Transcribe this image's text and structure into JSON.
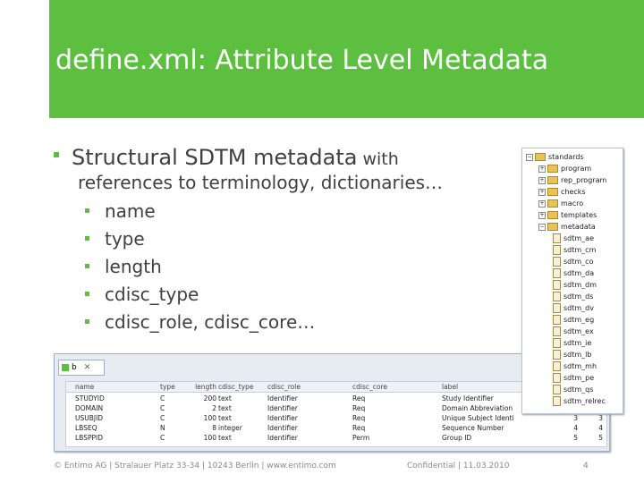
{
  "slide": {
    "title": "define.xml: Attribute Level Metadata",
    "bullet_main_large": "Structural SDTM metadata",
    "bullet_main_small": " with",
    "bullet_main_line2": "references to terminology, dictionaries…",
    "sub_bullets": [
      "name",
      "type",
      "length",
      "cdisc_type",
      "cdisc_role, cdisc_core…"
    ]
  },
  "tree": {
    "items": [
      {
        "label": "standards",
        "kind": "folder"
      },
      {
        "label": "program",
        "kind": "folder"
      },
      {
        "label": "rep_program",
        "kind": "folder"
      },
      {
        "label": "checks",
        "kind": "folder"
      },
      {
        "label": "macro",
        "kind": "folder"
      },
      {
        "label": "templates",
        "kind": "folder"
      },
      {
        "label": "metadata",
        "kind": "folder"
      },
      {
        "label": "sdtm_ae",
        "kind": "file"
      },
      {
        "label": "sdtm_cm",
        "kind": "file"
      },
      {
        "label": "sdtm_co",
        "kind": "file"
      },
      {
        "label": "sdtm_da",
        "kind": "file"
      },
      {
        "label": "sdtm_dm",
        "kind": "file"
      },
      {
        "label": "sdtm_ds",
        "kind": "file"
      },
      {
        "label": "sdtm_dv",
        "kind": "file"
      },
      {
        "label": "sdtm_eg",
        "kind": "file"
      },
      {
        "label": "sdtm_ex",
        "kind": "file"
      },
      {
        "label": "sdtm_ie",
        "kind": "file"
      },
      {
        "label": "sdtm_lb",
        "kind": "file"
      },
      {
        "label": "sdtm_mh",
        "kind": "file"
      },
      {
        "label": "sdtm_pe",
        "kind": "file"
      },
      {
        "label": "sdtm_qs",
        "kind": "file"
      },
      {
        "label": "sdtm_relrec",
        "kind": "file"
      }
    ]
  },
  "sheet": {
    "tab_label": "b",
    "columns": [
      "name",
      "type",
      "length",
      "cdisc_type",
      "cdisc_role",
      "cdisc_core",
      "label",
      "",
      ""
    ],
    "rows": [
      [
        "STUDYID",
        "C",
        "200",
        "text",
        "Identifier",
        "Req",
        "Study Identifier",
        "",
        ""
      ],
      [
        "DOMAIN",
        "C",
        "2",
        "text",
        "Identifier",
        "Req",
        "Domain Abbreviation",
        "",
        ""
      ],
      [
        "USUBJID",
        "C",
        "100",
        "text",
        "Identifier",
        "Req",
        "Unique Subject Identi",
        "3",
        "3"
      ],
      [
        "LBSEQ",
        "N",
        "8",
        "integer",
        "Identifier",
        "Req",
        "Sequence Number",
        "4",
        "4"
      ],
      [
        "LBSPPID",
        "C",
        "100",
        "text",
        "Identifier",
        "Perm",
        "Group ID",
        "5",
        "5"
      ]
    ]
  },
  "footer": {
    "left": "© Entimo AG | Stralauer Platz 33-34 | 10243 Berlin | www.entimo.com",
    "center": "Confidential | 11.03.2010",
    "page": "4"
  },
  "colors": {
    "accent": "#5cbf3f",
    "text": "#404040"
  }
}
